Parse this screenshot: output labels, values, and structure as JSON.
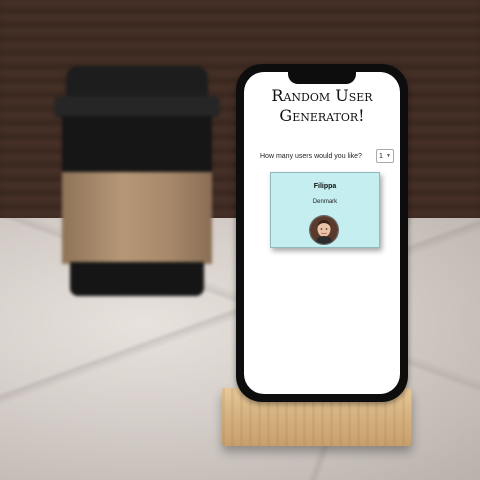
{
  "app": {
    "title": "Random User Generator!"
  },
  "form": {
    "question": "How many users would you like?",
    "selected_count": "1"
  },
  "users": [
    {
      "name": "Filippa",
      "country": "Denmark"
    }
  ]
}
